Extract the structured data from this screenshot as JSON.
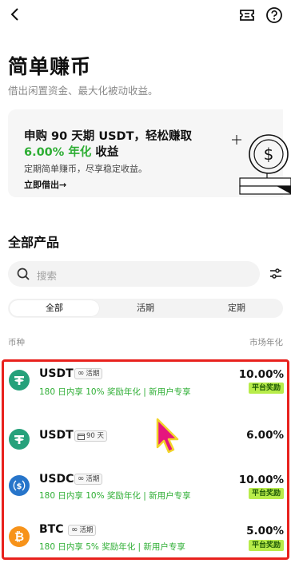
{
  "header": {
    "back_icon": "chevron-left-icon",
    "ticket_icon": "ticket-icon",
    "help_icon": "question-circle-icon"
  },
  "page": {
    "title": "简单赚币",
    "subtitle": "借出闲置资金、最大化被动收益。"
  },
  "banner": {
    "line1": "申购 90 天期 USDT，轻松赚取",
    "line2_green": "6.00% 年化",
    "line2_rest": " 收益",
    "desc": "定期简单赚币，尽享稳定收益。",
    "cta": "立即借出→"
  },
  "products": {
    "section_title": "全部产品",
    "search_placeholder": "搜索",
    "tabs": [
      "全部",
      "活期",
      "定期"
    ],
    "active_tab": 0,
    "col_coin": "币种",
    "col_apr": "市场年化"
  },
  "rows": [
    {
      "coin": "USDT",
      "icon_color": "#26a17b",
      "tag": "活期",
      "tag_icon": "infinity-icon",
      "promo": "180 日内享 10% 奖励年化 | 新用户专享",
      "apr": "10.00%",
      "badge": "平台奖励"
    },
    {
      "coin": "USDT",
      "icon_color": "#26a17b",
      "tag": "90 天",
      "tag_icon": "calendar-icon",
      "promo": "",
      "apr": "6.00%",
      "badge": ""
    },
    {
      "coin": "USDC",
      "icon_color": "#2775ca",
      "tag": "活期",
      "tag_icon": "infinity-icon",
      "promo": "180 日内享 10% 奖励年化 | 新用户专享",
      "apr": "10.00%",
      "badge": "平台奖励"
    },
    {
      "coin": "BTC",
      "icon_color": "#f7931a",
      "tag": "活期",
      "tag_icon": "infinity-icon",
      "promo": "180 日内享 5% 奖励年化 | 新用户专享",
      "apr": "5.00%",
      "badge": "平台奖励"
    }
  ],
  "colors": {
    "accent_green": "#2eae34",
    "badge_bg": "#b8ec4a",
    "highlight_border": "#e8211d"
  }
}
